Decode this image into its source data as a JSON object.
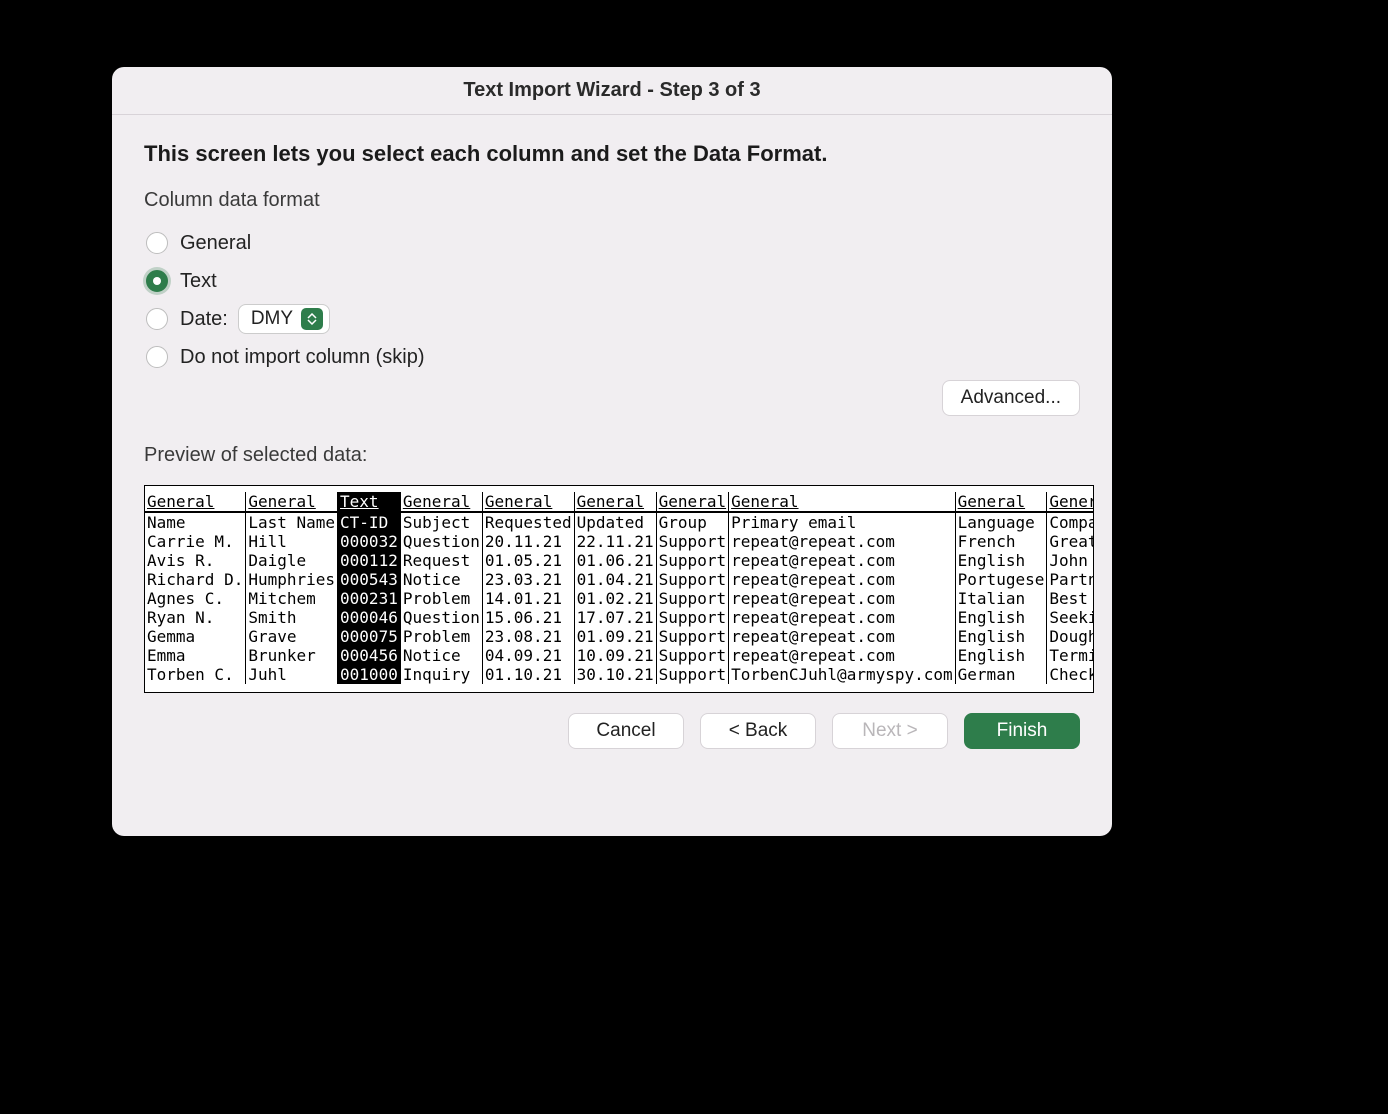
{
  "title": "Text Import Wizard - Step 3 of 3",
  "instruction": "This screen lets you select each column and set the Data Format.",
  "format_section": "Column data format",
  "radios": {
    "general": "General",
    "text": "Text",
    "date": "Date:",
    "date_value": "DMY",
    "skip": "Do not import column (skip)"
  },
  "advanced": "Advanced...",
  "preview_label": "Preview of selected data:",
  "columns": [
    {
      "format": "General"
    },
    {
      "format": "General"
    },
    {
      "format": "Text",
      "selected": true
    },
    {
      "format": "General"
    },
    {
      "format": "General"
    },
    {
      "format": "General"
    },
    {
      "format": "General"
    },
    {
      "format": "General"
    },
    {
      "format": "General"
    },
    {
      "format": "General"
    }
  ],
  "rows": [
    [
      "Name",
      "Last Name",
      "CT-ID",
      "Subject",
      "Requested",
      "Updated",
      "Group",
      "Primary email",
      "Language",
      "Company"
    ],
    [
      "Carrie M.",
      "Hill",
      "000032",
      "Question",
      "20.11.21",
      "22.11.21",
      "Support",
      "repeat@repeat.com",
      "French",
      "Great Comp"
    ],
    [
      "Avis R.",
      "Daigle",
      "000112",
      "Request",
      "01.05.21",
      "01.06.21",
      "Support",
      "repeat@repeat.com",
      "English",
      "John Free"
    ],
    [
      "Richard D.",
      "Humphries",
      "000543",
      "Notice",
      "23.03.21",
      "01.04.21",
      "Support",
      "repeat@repeat.com",
      "Portugese",
      "Partner Wo"
    ],
    [
      "Agnes C.",
      "Mitchem",
      "000231",
      "Problem",
      "14.01.21",
      "01.02.21",
      "Support",
      "repeat@repeat.com",
      "Italian",
      "Best Ticke"
    ],
    [
      "Ryan N.",
      "Smith",
      "000046",
      "Question",
      "15.06.21",
      "17.07.21",
      "Support",
      "repeat@repeat.com",
      "English",
      "Seeking Al"
    ],
    [
      "Gemma",
      "Grave",
      "000075",
      "Problem",
      "23.08.21",
      "01.09.21",
      "Support",
      "repeat@repeat.com",
      "English",
      "Doughnet"
    ],
    [
      "Emma",
      "Brunker",
      "000456",
      "Notice",
      "04.09.21",
      "10.09.21",
      "Support",
      "repeat@repeat.com",
      "English",
      "Terminator"
    ],
    [
      "Torben C.",
      "Juhl",
      "001000",
      "Inquiry",
      "01.10.21",
      "30.10.21",
      "Support",
      "TorbenCJuhl@armyspy.com",
      "German",
      "Checkers"
    ]
  ],
  "buttons": {
    "cancel": "Cancel",
    "back": "< Back",
    "next": "Next >",
    "finish": "Finish"
  }
}
